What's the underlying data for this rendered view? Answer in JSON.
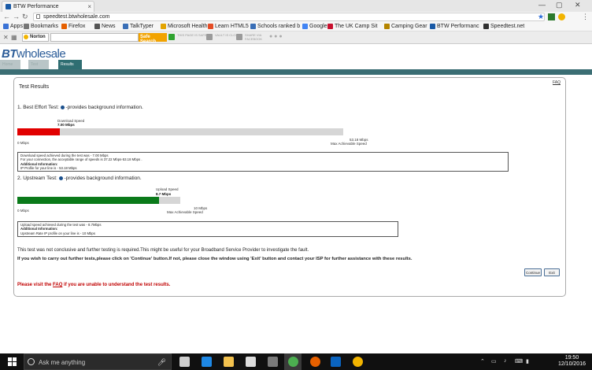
{
  "browser": {
    "tab_title": "BTW Performance",
    "url": "speedtest.btwholesale.com",
    "bookmarks": [
      {
        "label": "Apps",
        "color": "#3b73d6"
      },
      {
        "label": "Bookmarks",
        "color": "#777777"
      },
      {
        "label": "Firefox",
        "color": "#e66000"
      },
      {
        "label": "News",
        "color": "#555555"
      },
      {
        "label": "TalkTyper",
        "color": "#3a6fb7"
      },
      {
        "label": "Microsoft Health",
        "color": "#e3a400"
      },
      {
        "label": "Learn HTML5",
        "color": "#e44d26"
      },
      {
        "label": "Schools ranked b",
        "color": "#3a6fb7"
      },
      {
        "label": "Google",
        "color": "#4285f4"
      },
      {
        "label": "The UK Camp Sit",
        "color": "#c8102e"
      },
      {
        "label": "Camping Gear",
        "color": "#b58500"
      },
      {
        "label": "BTW Performanc",
        "color": "#1a5aa6"
      },
      {
        "label": "Speedtest.net",
        "color": "#333333"
      }
    ]
  },
  "norton": {
    "logo": "Norton",
    "safe_search": "Safe Search",
    "badges": [
      {
        "label": "THIS PAGE IS SAFE",
        "color": "#2fa32f"
      },
      {
        "label": "VAULT IS CLOSED",
        "color": "#9a9a9a"
      },
      {
        "label": "SHARE VIA FACEBOOK",
        "color": "#9a9a9a"
      }
    ]
  },
  "site": {
    "logo_bt": "BT",
    "logo_wholesale": "wholesale",
    "nav": [
      "Home",
      "Test",
      "Results"
    ],
    "active_tab": "Results"
  },
  "results": {
    "title": "Test Results",
    "faq": "FAQ",
    "best_effort": {
      "heading_prefix": "1. Best Effort Test:",
      "heading_suffix": "-provides background information.",
      "bar_label": "Download Speed",
      "speed_text": "7.00 Mbps",
      "download_mbps": 7.0,
      "max_mbps": 53.18,
      "min_label": "0 Mbps",
      "max_label": "53.18 Mbps",
      "max_caption": "Max Achievable Speed",
      "info_line1": "Download speed achieved during the test was - 7.00 Mbps",
      "info_line2": "For your connection, the acceptable range of speeds is 37.22 Mbps-53.18 Mbps .",
      "info_line3": "Additional Information:",
      "info_line4": "IP Profile for your line is - 53.18 Mbps"
    },
    "upstream": {
      "heading_prefix": "2. Upstream Test:",
      "heading_suffix": "-provides background information.",
      "bar_label": "Upload Speed",
      "speed_text": "8.7 Mbps",
      "upload_mbps": 8.7,
      "max_mbps": 10,
      "min_label": "0 Mbps",
      "max_label": "10 Mbps",
      "max_caption": "Max Achievable Speed",
      "info_line1": "Upload speed achieved during the test was - 8.7Mbps",
      "info_line2": "Additional Information:",
      "info_line3": "Upstream Rate IP profile on your line is - 10 Mbps"
    },
    "message1": "This test was not conclusive and further testing is required.This might be useful for your Broadband Service Provider to investigate the fault.",
    "message2": "If you wish to carry out further tests,please click on 'Continue' button.If not, please close the window using 'Exit' button and contact your ISP for further assistance with these results.",
    "continue_label": "Continue",
    "exit_label": "Exit",
    "visit_prefix": "Please visit the",
    "visit_link": "FAQ",
    "visit_suffix": "if you are unable to understand the test results."
  },
  "taskbar": {
    "search_placeholder": "Ask me anything",
    "time": "19:50",
    "date": "12/10/2016",
    "apps": [
      {
        "name": "task-view",
        "color": "#cfcfcf"
      },
      {
        "name": "edge",
        "color": "#1e88e5"
      },
      {
        "name": "file-explorer",
        "color": "#f2c14e"
      },
      {
        "name": "store",
        "color": "#dcdcdc"
      },
      {
        "name": "spotify-like",
        "color": "#7a7a7a"
      },
      {
        "name": "chrome",
        "color": "#4caf50"
      },
      {
        "name": "firefox",
        "color": "#e66000"
      },
      {
        "name": "outlook",
        "color": "#0a64c0"
      },
      {
        "name": "norton",
        "color": "#f2b400"
      }
    ]
  }
}
